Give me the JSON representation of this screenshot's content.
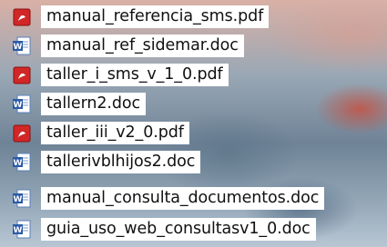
{
  "desktop": {
    "files": [
      {
        "name": "manual_referencia_sms.pdf",
        "type": "pdf",
        "icon": "pdf-file-icon"
      },
      {
        "name": "manual_ref_sidemar.doc",
        "type": "doc",
        "icon": "word-doc-icon"
      },
      {
        "name": "taller_i_sms_v_1_0.pdf",
        "type": "pdf",
        "icon": "pdf-file-icon"
      },
      {
        "name": "tallern2.doc",
        "type": "doc",
        "icon": "word-doc-icon"
      },
      {
        "name": "taller_iii_v2_0.pdf",
        "type": "pdf",
        "icon": "pdf-file-icon"
      },
      {
        "name": "tallerivblhijos2.doc",
        "type": "doc",
        "icon": "word-doc-icon"
      },
      {
        "name": "manual_consulta_documentos.doc",
        "type": "doc",
        "icon": "word-doc-icon"
      },
      {
        "name": "guia_uso_web_consultasv1_0.doc",
        "type": "doc",
        "icon": "word-doc-icon"
      }
    ]
  }
}
